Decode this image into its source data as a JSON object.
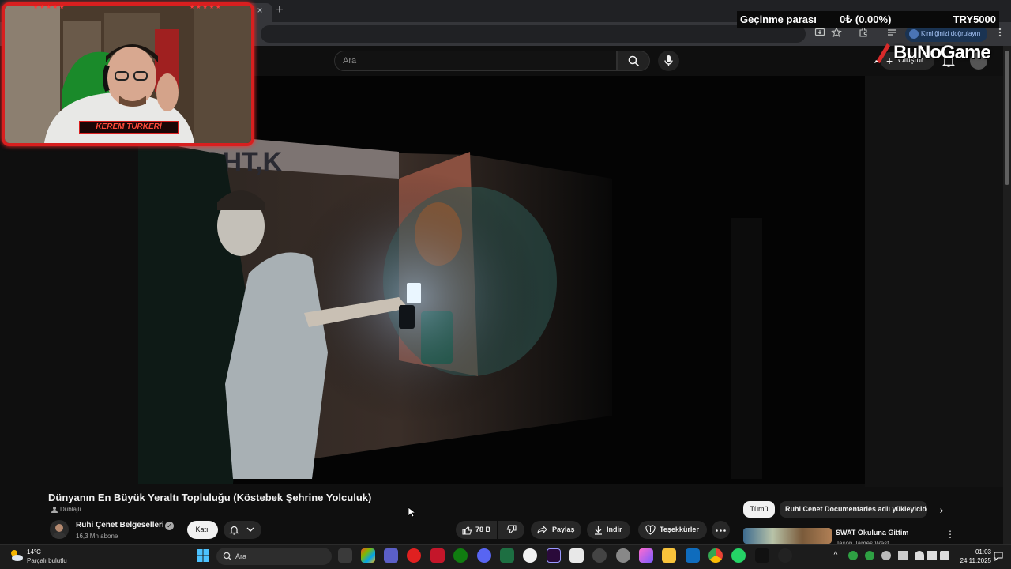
{
  "browser": {
    "verify_label": "Kimliğinizi doğrulayın",
    "new_tab_glyph": "+",
    "close_glyph": "×"
  },
  "overlay": {
    "ticker_label": "Geçinme parası",
    "ticker_value": "0₺ (0.00%)",
    "ticker_goal": "TRY5000",
    "brand": "BuNoGame",
    "streamer_name": "KEREM TÜRKERİ"
  },
  "youtube": {
    "search_placeholder": "Ara",
    "create_label": "Oluştur"
  },
  "video": {
    "title": "Dünyanın En Büyük Yeraltı Topluluğu (Köstebek Şehrine Yolculuk)",
    "dub_label": "Dublajlı",
    "channel_name": "Ruhi Çenet Belgeselleri",
    "subscribers": "16,3 Mn abone",
    "join_label": "Katıl",
    "likes": "78 B",
    "share_label": "Paylaş",
    "download_label": "İndir",
    "thanks_label": "Teşekkürler",
    "graffiti": "GHT,K"
  },
  "recommendations": {
    "chip_all": "Tümü",
    "chip_channel": "Ruhi Cenet Documentaries adlı yükleyiciden",
    "item_title": "SWAT Okuluna Gittim",
    "item_channel": "Jason James West"
  },
  "taskbar": {
    "weather_temp": "14°C",
    "weather_desc": "Parçalı bulutlu",
    "search_label": "Ara",
    "time": "01:03",
    "date": "24.11.2025"
  },
  "colors": {
    "overlay_red": "#d81f1f",
    "yt_bg": "#0f0f0f",
    "pill_bg": "#272727"
  }
}
